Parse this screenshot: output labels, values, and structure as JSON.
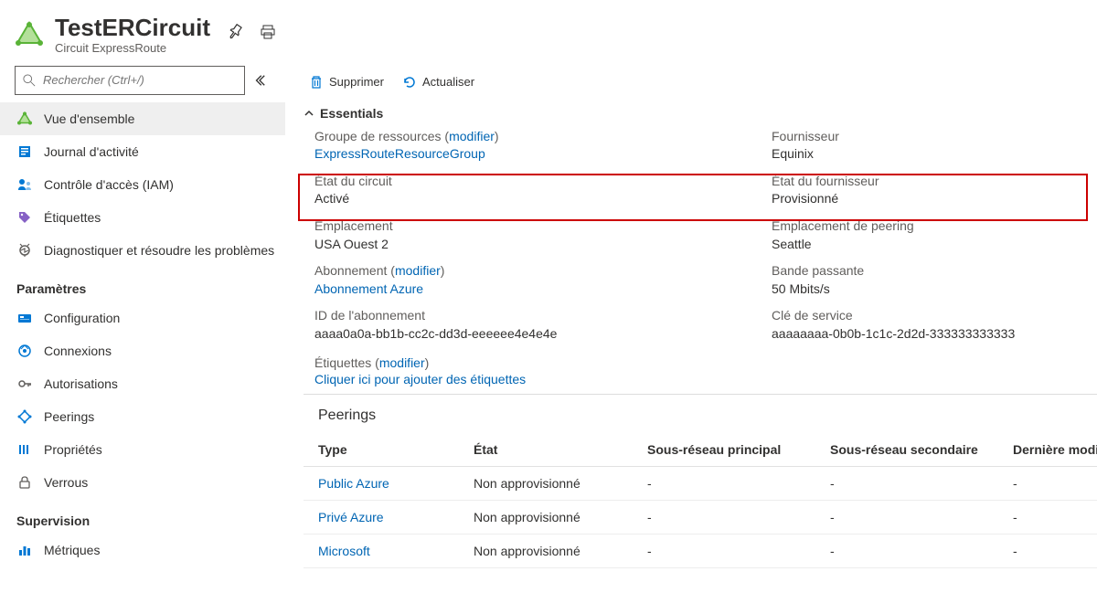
{
  "header": {
    "title": "TestERCircuit",
    "subtitle": "Circuit ExpressRoute"
  },
  "search": {
    "placeholder": "Rechercher (Ctrl+/)"
  },
  "nav": {
    "items_top": [
      {
        "label": "Vue d'ensemble",
        "icon": "expressroute"
      },
      {
        "label": "Journal d'activité",
        "icon": "activity-log"
      },
      {
        "label": "Contrôle d'accès (IAM)",
        "icon": "iam"
      },
      {
        "label": "Étiquettes",
        "icon": "tag"
      },
      {
        "label": "Diagnostiquer et résoudre les problèmes",
        "icon": "diagnose"
      }
    ],
    "section_settings": "Paramètres",
    "items_settings": [
      {
        "label": "Configuration",
        "icon": "config"
      },
      {
        "label": "Connexions",
        "icon": "connections"
      },
      {
        "label": "Autorisations",
        "icon": "auth"
      },
      {
        "label": "Peerings",
        "icon": "peerings"
      },
      {
        "label": "Propriétés",
        "icon": "properties"
      },
      {
        "label": "Verrous",
        "icon": "locks"
      }
    ],
    "section_supervision": "Supervision",
    "items_supervision": [
      {
        "label": "Métriques",
        "icon": "metrics"
      }
    ]
  },
  "toolbar": {
    "delete": "Supprimer",
    "refresh": "Actualiser"
  },
  "essentials": {
    "title": "Essentials",
    "resource_group_label": "Groupe de ressources",
    "modify": "modifier",
    "resource_group_value": "ExpressRouteResourceGroup",
    "provider_label": "Fournisseur",
    "provider_value": "Equinix",
    "circuit_state_label": "État du circuit",
    "circuit_state_value": "Activé",
    "provider_state_label": "État du fournisseur",
    "provider_state_value": "Provisionné",
    "location_label": "Emplacement",
    "location_value": "USA Ouest 2",
    "peering_loc_label": "Emplacement de peering",
    "peering_loc_value": "Seattle",
    "subscription_label": "Abonnement",
    "subscription_value": "Abonnement Azure",
    "bandwidth_label": "Bande passante",
    "bandwidth_value": "50 Mbits/s",
    "subscription_id_label": "ID de l'abonnement",
    "subscription_id_value": "aaaa0a0a-bb1b-cc2c-dd3d-eeeeee4e4e4e",
    "service_key_label": "Clé de service",
    "service_key_value": "aaaaaaaa-0b0b-1c1c-2d2d-333333333333",
    "tags_label": "Étiquettes",
    "tags_action": "Cliquer ici pour ajouter des étiquettes"
  },
  "peerings": {
    "title": "Peerings",
    "columns": {
      "type": "Type",
      "state": "État",
      "primary": "Sous-réseau principal",
      "secondary": "Sous-réseau secondaire",
      "last_mod": "Dernière modifica"
    },
    "rows": [
      {
        "type": "Public Azure",
        "state": "Non approvisionné",
        "primary": "-",
        "secondary": "-",
        "last_mod": "-"
      },
      {
        "type": "Privé Azure",
        "state": "Non approvisionné",
        "primary": "-",
        "secondary": "-",
        "last_mod": "-"
      },
      {
        "type": "Microsoft",
        "state": "Non approvisionné",
        "primary": "-",
        "secondary": "-",
        "last_mod": "-"
      }
    ]
  }
}
